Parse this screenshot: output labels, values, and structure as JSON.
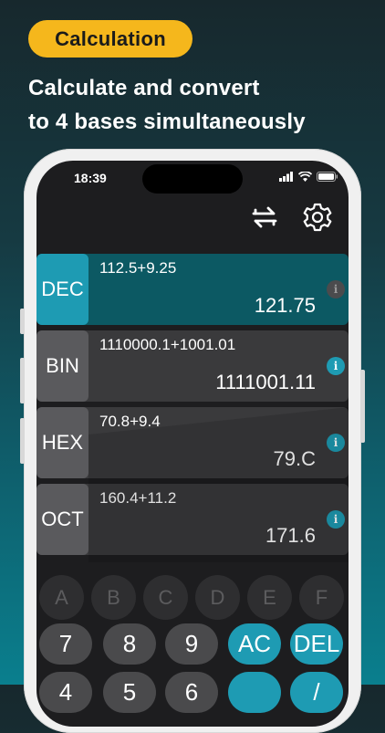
{
  "badge": {
    "label": "Calculation"
  },
  "headline": {
    "line1": "Calculate and convert",
    "line2": "to 4 bases simultaneously"
  },
  "status_bar": {
    "time": "18:39"
  },
  "toolbar": {
    "icons": [
      "swap-icon",
      "settings-icon"
    ]
  },
  "rows": [
    {
      "base": "DEC",
      "expression": "112.5+9.25",
      "result": "121.75",
      "active": true
    },
    {
      "base": "BIN",
      "expression": "1110000.1+1001.01",
      "result": "1111001.11",
      "active": false
    },
    {
      "base": "HEX",
      "expression": "70.8+9.4",
      "result": "79.C",
      "active": false
    },
    {
      "base": "OCT",
      "expression": "160.4+11.2",
      "result": "171.6",
      "active": false
    }
  ],
  "keypad": {
    "hex_row": [
      "A",
      "B",
      "C",
      "D",
      "E",
      "F"
    ],
    "row1": [
      "7",
      "8",
      "9",
      "AC",
      "DEL"
    ],
    "row2": [
      "4",
      "5",
      "6",
      "",
      "/"
    ]
  },
  "colors": {
    "accent": "#1e9bb3",
    "badge": "#f5b71c",
    "active_row": "#0c5963"
  }
}
